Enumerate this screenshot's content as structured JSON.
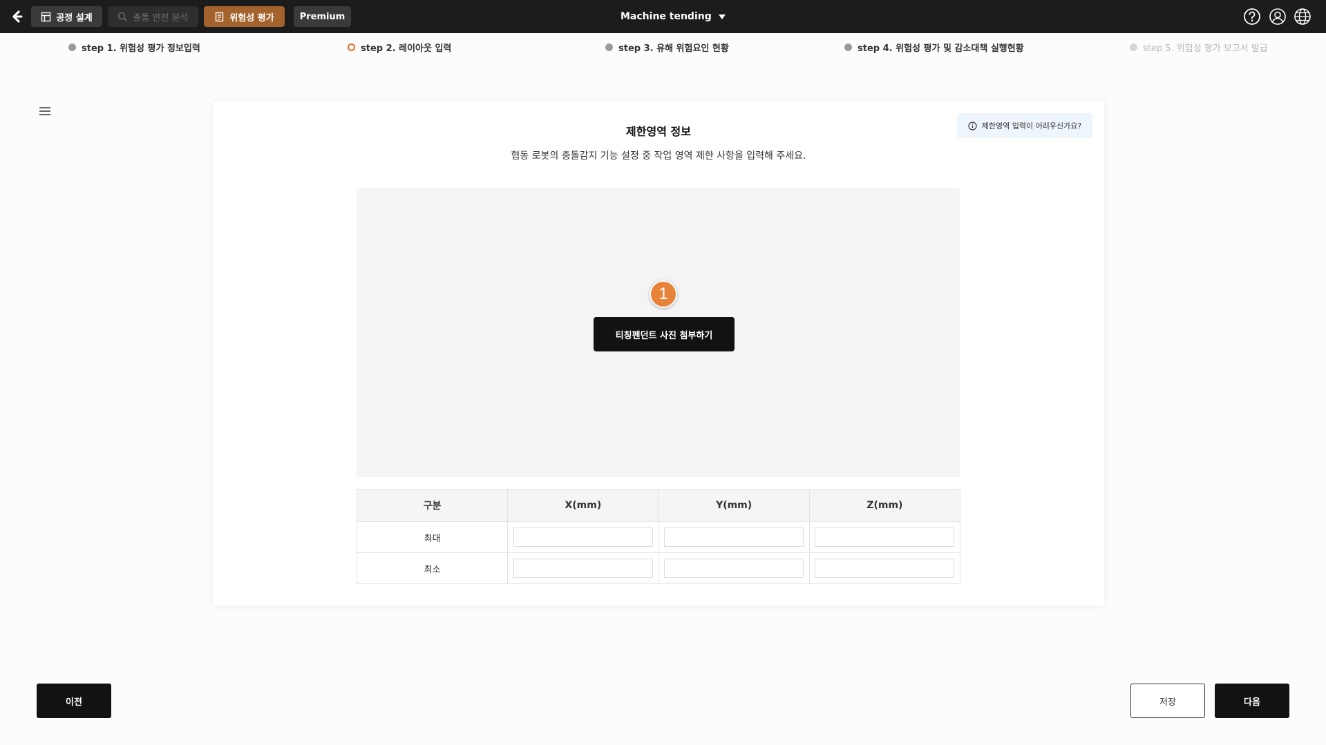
{
  "topbar": {
    "tabs": [
      {
        "label": "공정 설계",
        "state": "normal",
        "icon": "layout-icon"
      },
      {
        "label": "충돌 안전 분석",
        "state": "disabled",
        "icon": "search-analysis-icon"
      },
      {
        "label": "위험성 평가",
        "state": "active",
        "icon": "document-icon"
      },
      {
        "label": "Premium",
        "state": "normal"
      }
    ],
    "project": "Machine tending",
    "icons": [
      "help-icon",
      "user-icon",
      "globe-icon"
    ]
  },
  "steps": [
    {
      "label": "step 1. 위험성 평가 정보입력",
      "state": "done"
    },
    {
      "label": "step 2. 레이아웃 입력",
      "state": "current"
    },
    {
      "label": "step 3. 유해 위험요인 현황",
      "state": "done"
    },
    {
      "label": "step 4. 위험성 평가 및 감소대책 실행현황",
      "state": "done"
    },
    {
      "label": "step 5. 위험성 평가 보고서 발급",
      "state": "future"
    }
  ],
  "card": {
    "title": "제한영역 정보",
    "description": "협동 로봇의 충돌감지 기능 설정 중 작업 영역 제한 사항을 입력해 주세요.",
    "help": "제한영역 입력이 어려우신가요?",
    "marker": "1",
    "attach_button": "티칭펜던트 사진 첨부하기",
    "table": {
      "headers": [
        "구분",
        "X(mm)",
        "Y(mm)",
        "Z(mm)"
      ],
      "rows": [
        {
          "label": "최대",
          "x": "",
          "y": "",
          "z": ""
        },
        {
          "label": "최소",
          "x": "",
          "y": "",
          "z": ""
        }
      ]
    }
  },
  "footer": {
    "prev": "이전",
    "save": "저장",
    "next": "다음"
  },
  "colors": {
    "topbar": "#1c1c1c",
    "active_tab": "#a4622c",
    "current_step": "#e46a1f",
    "marker": "#e8833a"
  }
}
